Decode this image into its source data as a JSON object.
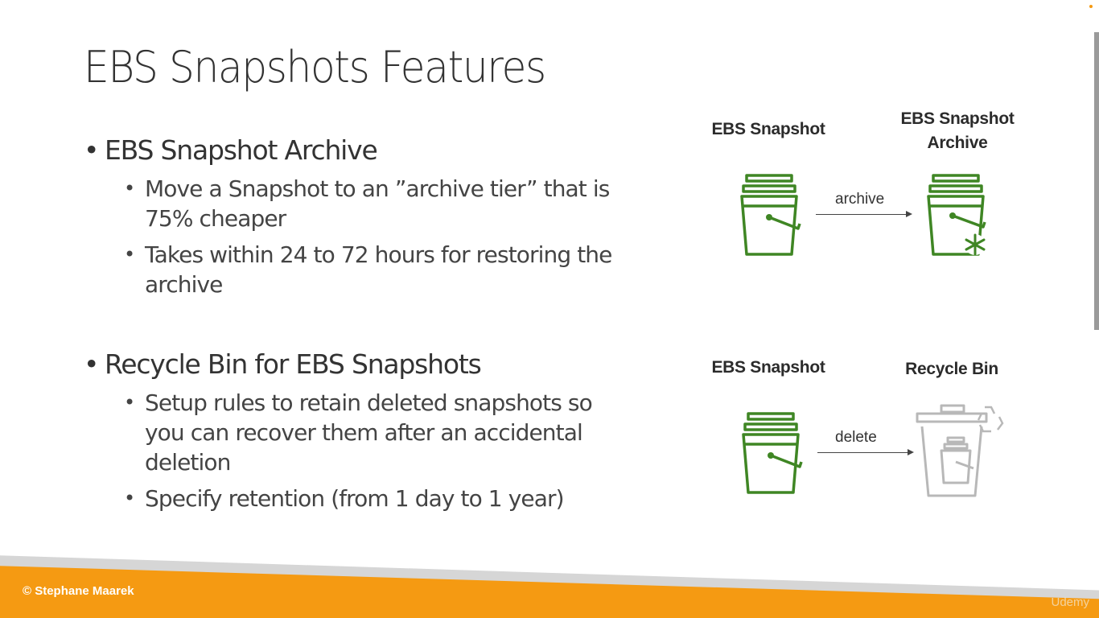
{
  "slide": {
    "title": "EBS Snapshots Features"
  },
  "sections": [
    {
      "heading": "EBS Snapshot Archive",
      "items": [
        "Move a Snapshot to an ”archive tier” that is 75% cheaper",
        "Takes within 24 to 72 hours for restoring the archive"
      ]
    },
    {
      "heading": "Recycle Bin for EBS Snapshots",
      "items": [
        "Setup rules to retain deleted snapshots so you can recover them after an accidental deletion",
        "Specify retention (from 1 day to 1 year)"
      ]
    }
  ],
  "diagram": {
    "archive_flow": {
      "source_label": "EBS Snapshot",
      "target_label_line1": "EBS Snapshot",
      "target_label_line2": "Archive",
      "arrow_label": "archive"
    },
    "delete_flow": {
      "source_label": "EBS Snapshot",
      "target_label": "Recycle Bin",
      "arrow_label": "delete"
    },
    "icon_color": "#3f8624"
  },
  "footer": {
    "copyright": "© Stephane Maarek",
    "watermark": "Udemy",
    "accent_color": "#f59a12"
  }
}
